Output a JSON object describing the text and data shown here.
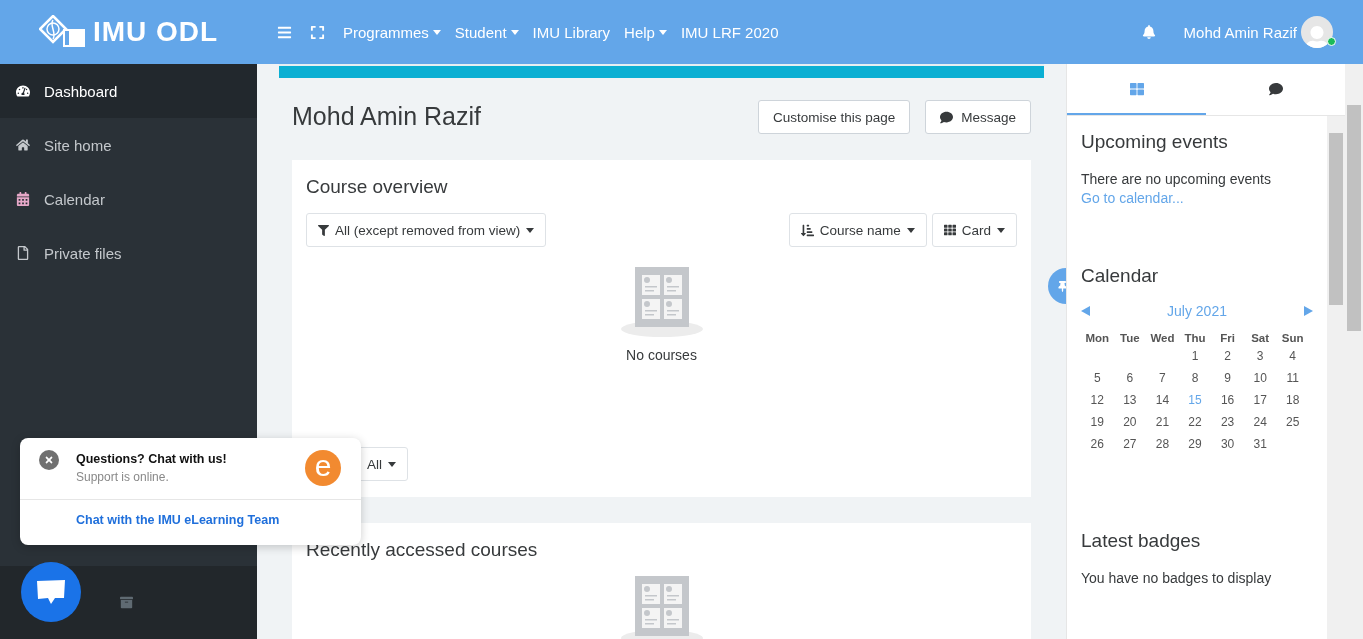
{
  "navbar": {
    "logo_text": "IMU ODL",
    "menu": [
      {
        "label": "Programmes",
        "dropdown": true
      },
      {
        "label": "Student",
        "dropdown": true
      },
      {
        "label": "IMU Library",
        "dropdown": false
      },
      {
        "label": "Help",
        "dropdown": true
      },
      {
        "label": "IMU LRF 2020",
        "dropdown": false
      }
    ],
    "user_name": "Mohd Amin Razif",
    "online": true
  },
  "sidebar": {
    "items": [
      {
        "kind": "dashboard",
        "label": "Dashboard",
        "selected": true
      },
      {
        "kind": "home",
        "label": "Site home",
        "selected": false
      },
      {
        "kind": "calendar",
        "label": "Calendar",
        "selected": false
      },
      {
        "kind": "files",
        "label": "Private files",
        "selected": false
      }
    ]
  },
  "page": {
    "title": "Mohd Amin Razif",
    "buttons": [
      {
        "kind": "customise",
        "label": "Customise this page"
      },
      {
        "kind": "message",
        "label": "Message"
      }
    ]
  },
  "course_overview": {
    "title": "Course overview",
    "filter": "All (except removed from view)",
    "sort": "Course name",
    "view": "Card",
    "empty_text": "No courses",
    "paging": "All"
  },
  "recent_courses": {
    "title": "Recently accessed courses"
  },
  "drawer": {
    "tabs": [
      {
        "kind": "blocks",
        "selected": true
      },
      {
        "kind": "messages",
        "selected": false
      }
    ],
    "upcoming": {
      "title": "Upcoming events",
      "text": "There are no upcoming events",
      "link": "Go to calendar..."
    },
    "calendar": {
      "title": "Calendar",
      "month": "July 2021",
      "weekdays": [
        "Mon",
        "Tue",
        "Wed",
        "Thu",
        "Fri",
        "Sat",
        "Sun"
      ],
      "weeks": [
        [
          {
            "d": "1",
            "today": false
          },
          {
            "d": "2",
            "today": false
          },
          {
            "d": "3",
            "today": false
          },
          {
            "d": "4",
            "today": false
          }
        ],
        [
          {
            "d": "5",
            "today": false
          },
          {
            "d": "6",
            "today": false
          },
          {
            "d": "7",
            "today": false
          },
          {
            "d": "8",
            "today": false
          },
          {
            "d": "9",
            "today": false
          },
          {
            "d": "10",
            "today": false
          },
          {
            "d": "11",
            "today": false
          }
        ],
        [
          {
            "d": "12",
            "today": false
          },
          {
            "d": "13",
            "today": false
          },
          {
            "d": "14",
            "today": false
          },
          {
            "d": "15",
            "today": true
          },
          {
            "d": "16",
            "today": false
          },
          {
            "d": "17",
            "today": false
          },
          {
            "d": "18",
            "today": false
          }
        ],
        [
          {
            "d": "19",
            "today": false
          },
          {
            "d": "20",
            "today": false
          },
          {
            "d": "21",
            "today": false
          },
          {
            "d": "22",
            "today": false
          },
          {
            "d": "23",
            "today": false
          },
          {
            "d": "24",
            "today": false
          },
          {
            "d": "25",
            "today": false
          }
        ],
        [
          {
            "d": "26",
            "today": false
          },
          {
            "d": "27",
            "today": false
          },
          {
            "d": "28",
            "today": false
          },
          {
            "d": "29",
            "today": false
          },
          {
            "d": "30",
            "today": false
          },
          {
            "d": "31",
            "today": false
          }
        ]
      ]
    },
    "badges": {
      "title": "Latest badges",
      "text": "You have no badges to display"
    }
  },
  "chat_popup": {
    "title": "Questions? Chat with us!",
    "status": "Support is online.",
    "link": "Chat with the IMU eLearning Team",
    "avatar_letter": "e"
  }
}
